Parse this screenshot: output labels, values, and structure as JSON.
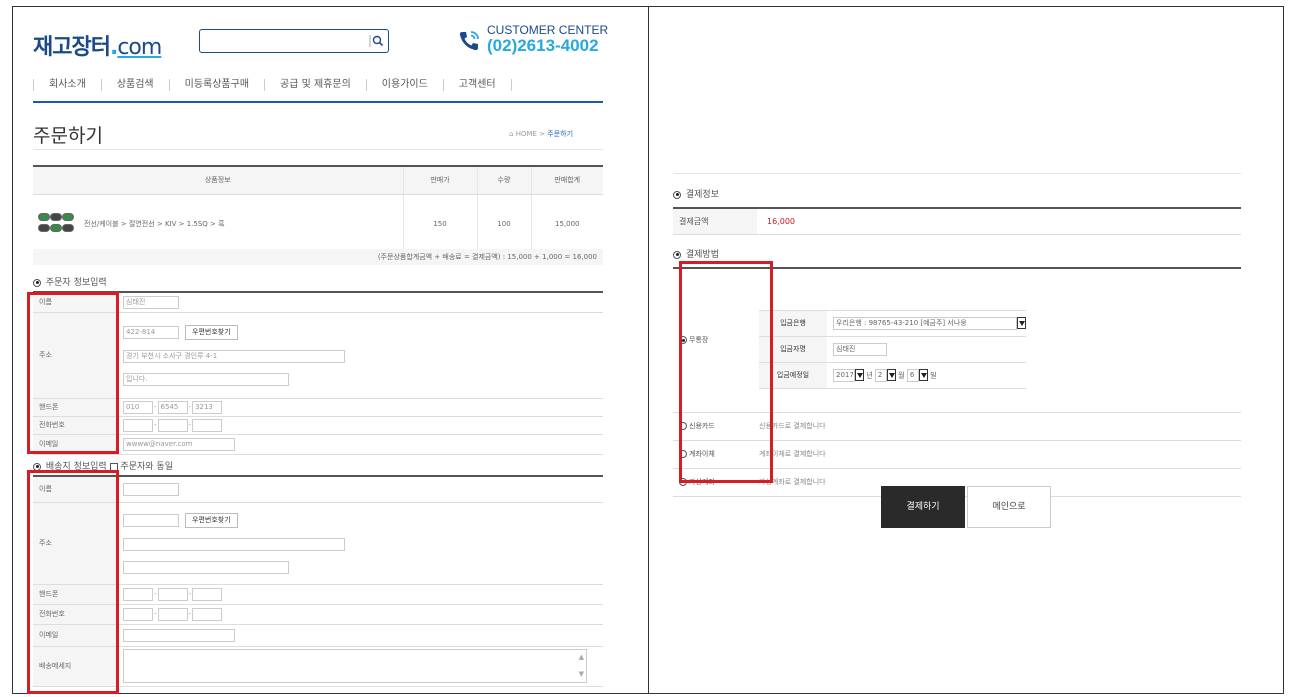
{
  "header": {
    "logo_main": "재고장터",
    "logo_com": "com",
    "cc_label": "CUSTOMER CENTER",
    "cc_phone": "(02)2613-4002"
  },
  "gnb": [
    "회사소개",
    "상품검색",
    "미등록상품구매",
    "공급 및 제휴문의",
    "이용가이드",
    "고객센터"
  ],
  "page": {
    "title": "주문하기",
    "crumb_home": "HOME",
    "crumb_sep": ">",
    "crumb_current": "주문하기"
  },
  "product_table": {
    "headers": [
      "상품정보",
      "판매가",
      "수량",
      "판매합계"
    ],
    "row": {
      "name": "전선/케이블 > 절연전선 > KIV > 1.5SQ > 흑",
      "price": "150",
      "qty": "100",
      "total": "15,000"
    },
    "summary": "(주문상품합계금액 + 배송료 = 결제금액) : 15,000 + 1,000 = 16,000"
  },
  "orderer": {
    "section_title": "주문자 정보입력",
    "labels": {
      "name": "이름",
      "address": "주소",
      "mobile": "핸드폰",
      "phone": "전화번호",
      "email": "이메일"
    },
    "name": "심태진",
    "zip": "422-814",
    "zip_button": "우편번호찾기",
    "addr1": "경기 부천시 소사구 경인루 4-1",
    "addr2": "입니다.",
    "mobile": [
      "010",
      "6545",
      "3213"
    ],
    "phone": [
      "",
      "",
      ""
    ],
    "email": "wwww@naver.com"
  },
  "shipping": {
    "section_title": "배송지 정보입력",
    "same_label": "주문자와 동일",
    "labels": {
      "name": "이름",
      "address": "주소",
      "mobile": "핸드폰",
      "phone": "전화번호",
      "email": "이메일",
      "message": "배송메세지"
    },
    "zip_button": "우편번호찾기"
  },
  "payment": {
    "info_title": "결제정보",
    "amount_label": "결제금액",
    "amount": "16,000",
    "method_title": "결제방법",
    "bank_option": "무통장",
    "bank_label": "입금은행",
    "bank_value": "우리은행 : 98765-43-210 [예금주] 서나웅",
    "depositor_label": "입금자명",
    "depositor_value": "심태진",
    "date_label": "입금예정일",
    "date_year": "2017",
    "date_year_unit": "년",
    "date_month": "2",
    "date_month_unit": "월",
    "date_day": "6",
    "date_day_unit": "일",
    "card_option": "신용카드",
    "card_desc": "신용카드로 결제합니다",
    "transfer_option": "계좌이체",
    "transfer_desc": "계좌이체로 결제합니다",
    "virtual_option": "가상계좌",
    "virtual_desc": "가상계좌로 결제합니다",
    "pay_button": "결제하기",
    "main_button": "메인으로"
  },
  "colors": {
    "brand": "#1a4a8a",
    "accent": "#28a8e0",
    "highlight_box": "#d81c24",
    "amount": "#c8161d"
  }
}
